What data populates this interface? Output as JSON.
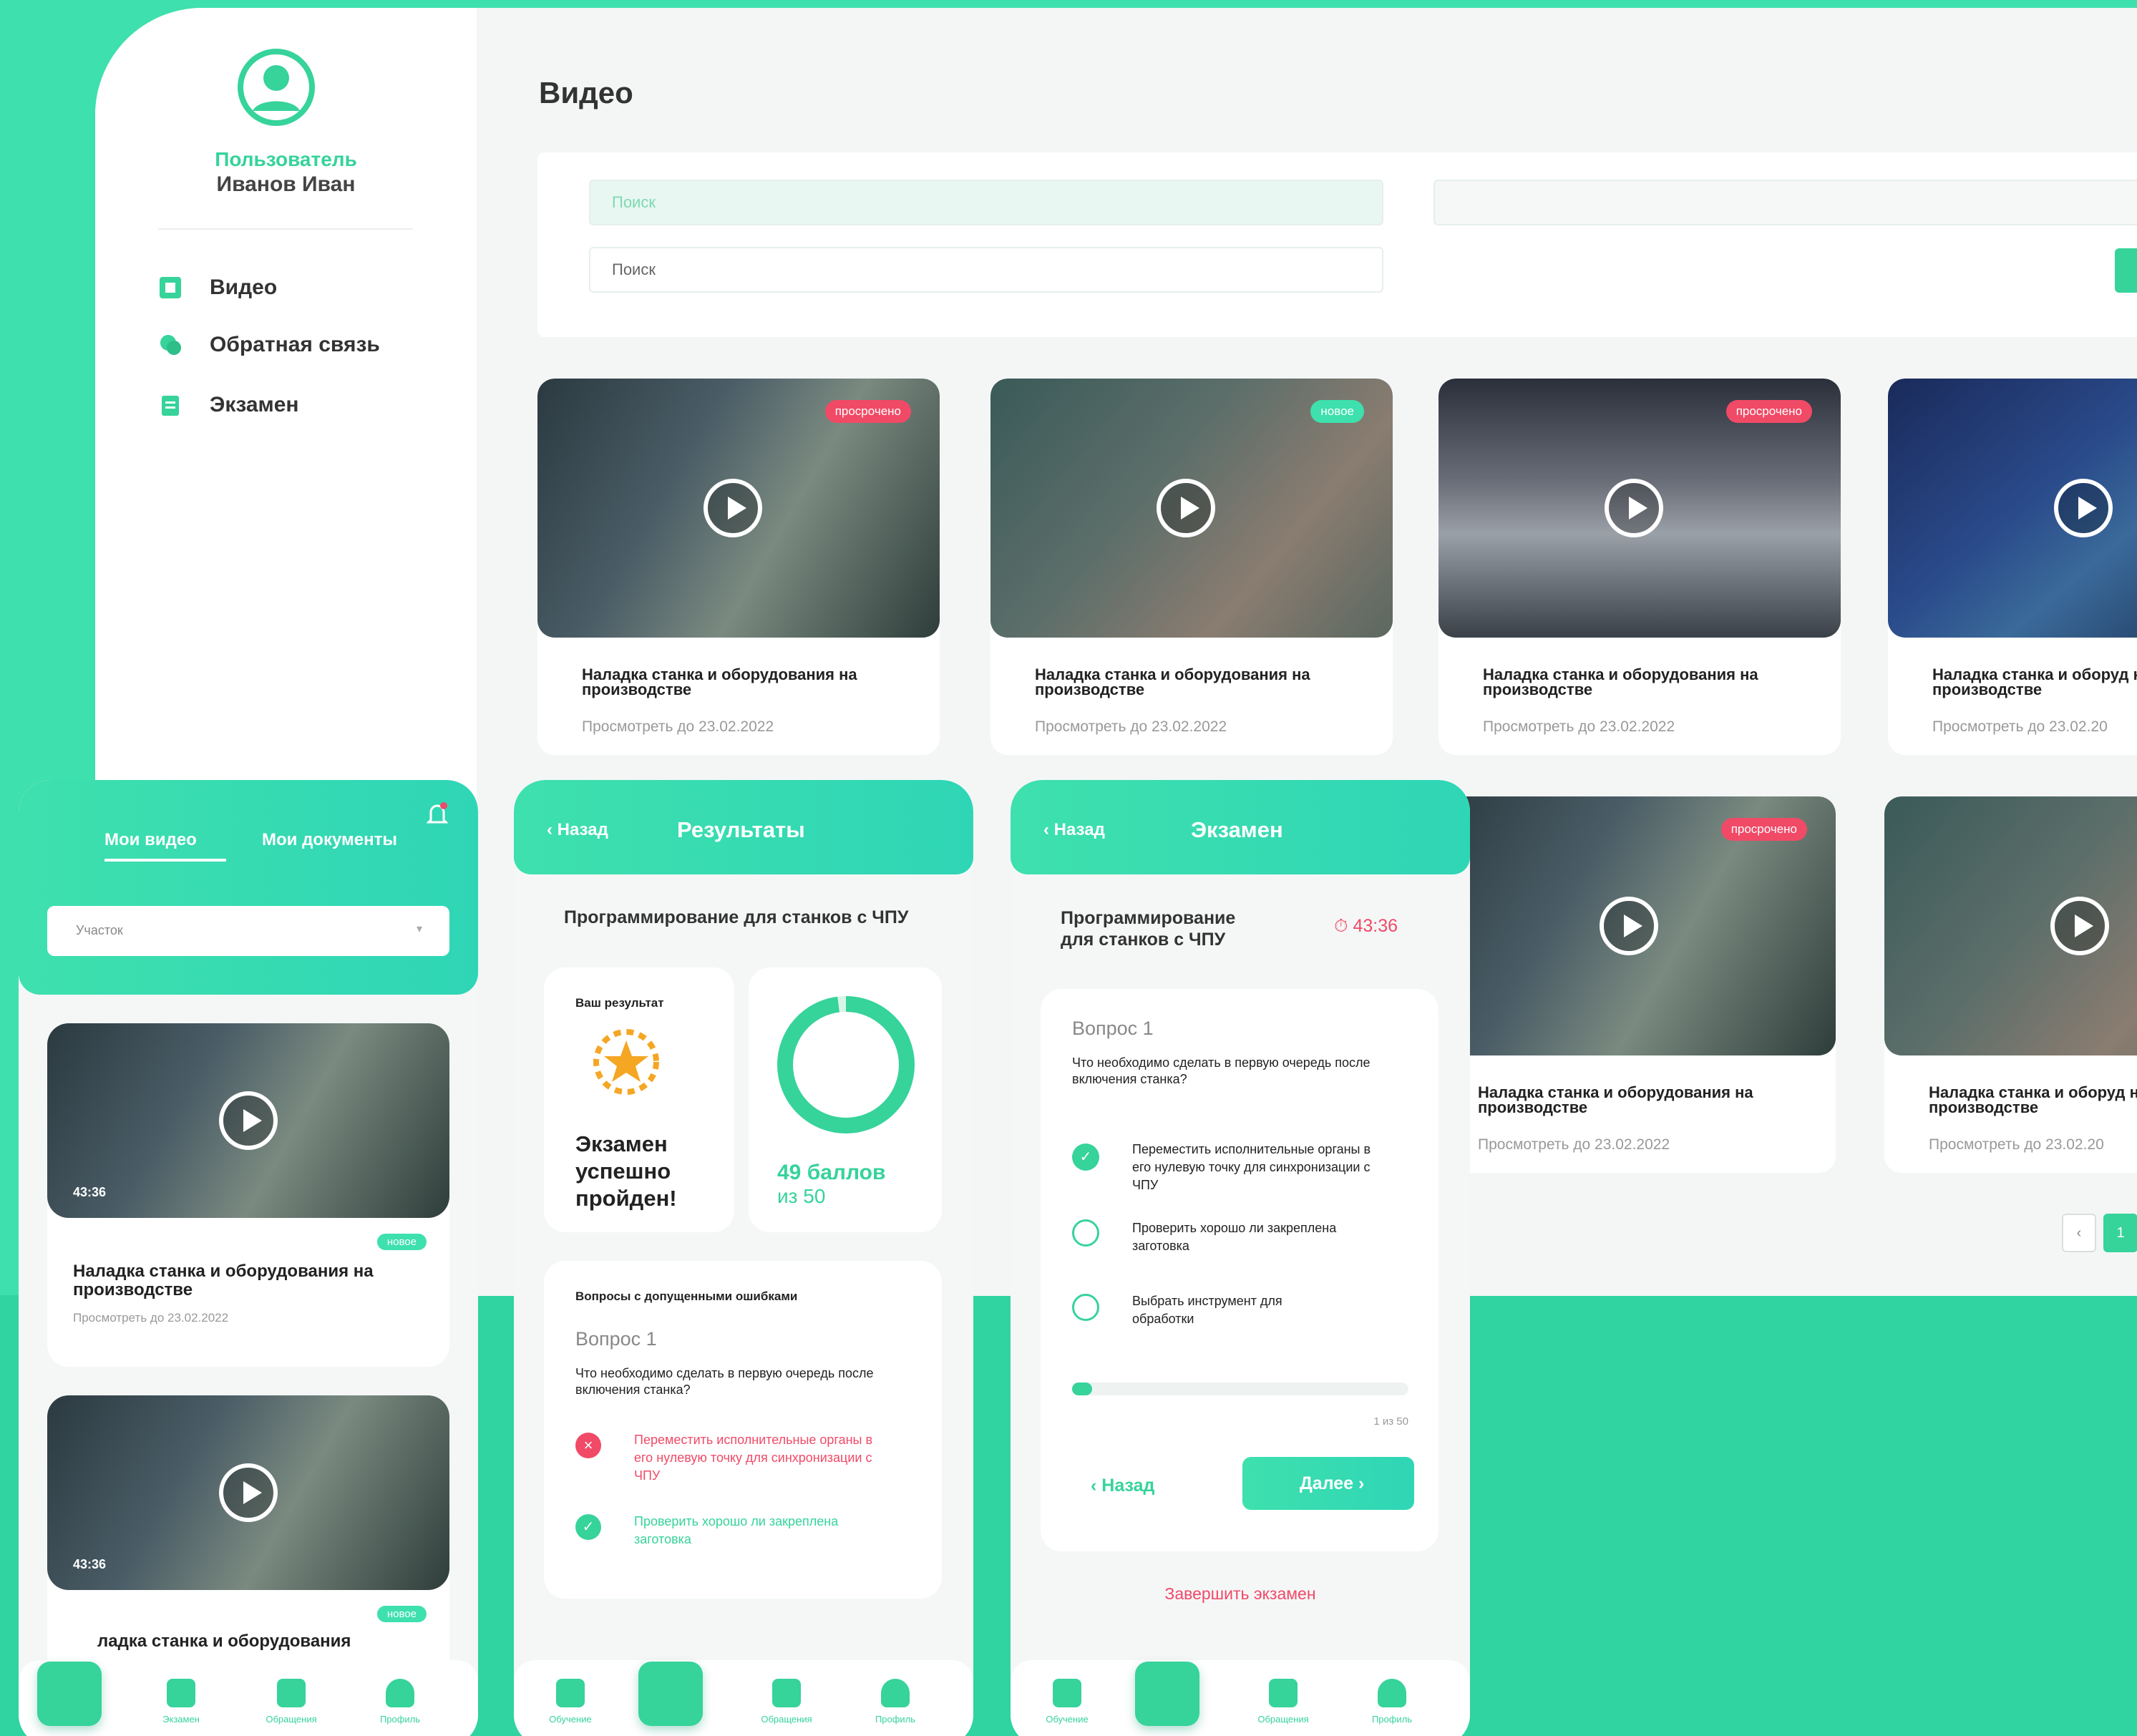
{
  "colors": {
    "accent": "#36d39b",
    "danger": "#f04a67",
    "background": "#3ee0ad"
  },
  "desktop": {
    "user_label": "Пользователь",
    "user_name": "Иванов Иван",
    "nav": [
      {
        "label": "Видео",
        "icon": "video-icon"
      },
      {
        "label": "Обратная связь",
        "icon": "chat-icon"
      },
      {
        "label": "Экзамен",
        "icon": "clipboard-icon"
      }
    ],
    "page_title": "Видео",
    "search_placeholder_1": "Поиск",
    "search_placeholder_2": "Поиск",
    "videos": [
      {
        "title": "Наладка станка и оборудования на производстве",
        "date": "Просмотреть до 23.02.2022",
        "tag": "просрочено"
      },
      {
        "title": "Наладка станка и оборудования на производстве",
        "date": "Просмотреть до 23.02.2022",
        "tag": "новое"
      },
      {
        "title": "Наладка станка и оборудования на производстве",
        "date": "Просмотреть до 23.02.2022",
        "tag": "просрочено"
      },
      {
        "title": "Наладка станка и оборуд на производстве",
        "date": "Просмотреть до 23.02.20",
        "tag": ""
      },
      {
        "title": "Наладка станка и оборудования на производстве",
        "date": "Просмотреть до 23.02.2022",
        "tag": "просрочено"
      },
      {
        "title": "Наладка станка и оборуд на производстве",
        "date": "Просмотреть до 23.02.20",
        "tag": ""
      }
    ],
    "pager": {
      "prev": "‹",
      "current": "1"
    }
  },
  "phone1": {
    "tabs": [
      "Мои видео",
      "Мои документы"
    ],
    "select": "Участок",
    "videos": [
      {
        "duration": "43:36",
        "tag": "новое",
        "title": "Наладка станка и оборудования на производстве",
        "date": "Просмотреть до 23.02.2022"
      },
      {
        "duration": "43:36",
        "tag": "новое",
        "title": "ладка станка и оборудования",
        "date": ""
      }
    ]
  },
  "phone2": {
    "back": "Назад",
    "title": "Результаты",
    "course": "Программирование для станков с ЧПУ",
    "result_label": "Ваш результат",
    "result_text": "Экзамен успешно пройден!",
    "score": "49 баллов",
    "score_of": "из 50",
    "score_value": 49,
    "score_max": 50,
    "errors_label": "Вопросы с допущенными ошибками",
    "question": "Вопрос 1",
    "question_text": "Что необходимо сделать в первую очередь после включения станка?",
    "answers": [
      {
        "text": "Переместить исполнительные органы в его нулевую точку для синхронизации с ЧПУ",
        "state": "wrong"
      },
      {
        "text": "Проверить хорошо ли закреплена заготовка",
        "state": "right"
      }
    ]
  },
  "phone3": {
    "back": "Назад",
    "title": "Экзамен",
    "course": "Программирование для станков с ЧПУ",
    "timer": "43:36",
    "question": "Вопрос 1",
    "question_text": "Что необходимо сделать в первую очередь после включения станка?",
    "options": [
      {
        "text": "Переместить исполнительные органы в его нулевую точку для синхронизации с ЧПУ",
        "checked": true
      },
      {
        "text": "Проверить хорошо ли закреплена заготовка",
        "checked": false
      },
      {
        "text": "Выбрать инструмент для обработки",
        "checked": false
      }
    ],
    "progress": "1 из 50",
    "progress_value": 0.02,
    "prev": "Назад",
    "next": "Далее",
    "finish": "Завершить экзамен"
  },
  "tabbar": [
    "Обучение",
    "Экзамен",
    "Обращения",
    "Профиль"
  ]
}
